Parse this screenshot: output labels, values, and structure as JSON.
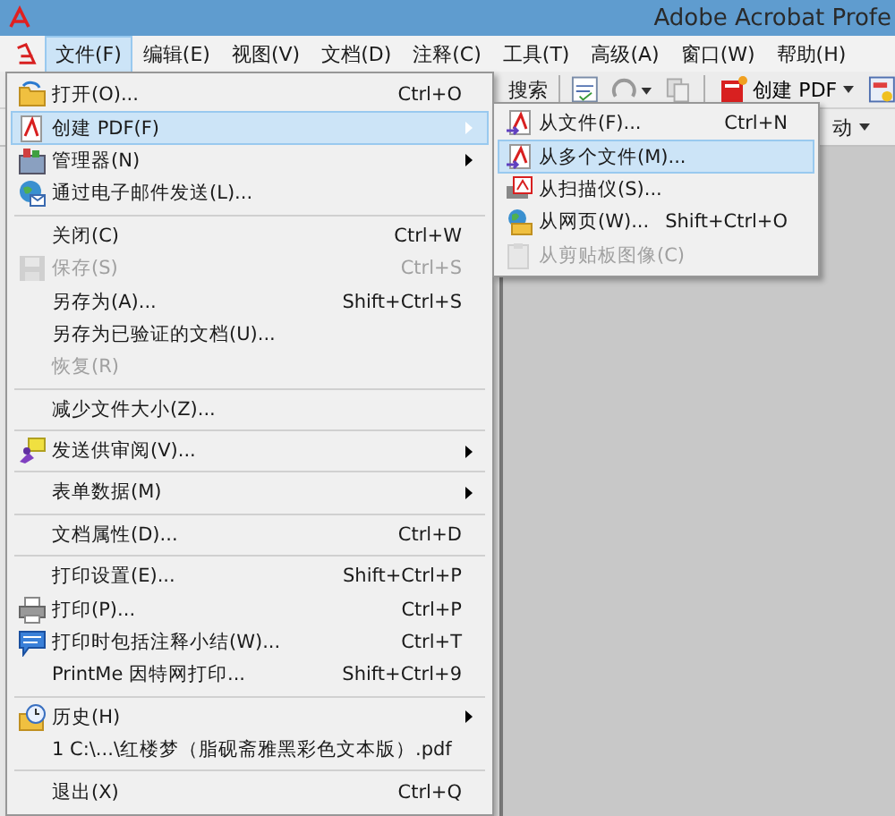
{
  "window": {
    "title": "Adobe Acrobat Profe"
  },
  "menubar": [
    {
      "label": "文件(F)",
      "selected": true
    },
    {
      "label": "编辑(E)",
      "selected": false
    },
    {
      "label": "视图(V)",
      "selected": false
    },
    {
      "label": "文档(D)",
      "selected": false
    },
    {
      "label": "注释(C)",
      "selected": false
    },
    {
      "label": "工具(T)",
      "selected": false
    },
    {
      "label": "高级(A)",
      "selected": false
    },
    {
      "label": "窗口(W)",
      "selected": false
    },
    {
      "label": "帮助(H)",
      "selected": false
    }
  ],
  "toolbar": {
    "search": "搜索",
    "create_pdf": "创建 PDF",
    "row2_text": "动"
  },
  "file_menu": [
    {
      "kind": "item",
      "label": "打开(O)...",
      "shortcut": "Ctrl+O",
      "disabled": false,
      "selected": false,
      "submenu": false
    },
    {
      "kind": "item",
      "label": "创建 PDF(F)",
      "disabled": false,
      "selected": true,
      "submenu": true
    },
    {
      "kind": "item",
      "label": "管理器(N)",
      "disabled": false,
      "selected": false,
      "submenu": true
    },
    {
      "kind": "item",
      "label": "通过电子邮件发送(L)...",
      "disabled": false,
      "selected": false,
      "submenu": false
    },
    {
      "kind": "separator"
    },
    {
      "kind": "item",
      "label": "关闭(C)",
      "shortcut": "Ctrl+W",
      "disabled": false,
      "selected": false,
      "submenu": false
    },
    {
      "kind": "item",
      "label": "保存(S)",
      "shortcut": "Ctrl+S",
      "disabled": true,
      "selected": false,
      "submenu": false
    },
    {
      "kind": "item",
      "label": "另存为(A)...",
      "shortcut": "Shift+Ctrl+S",
      "disabled": false,
      "selected": false,
      "submenu": false
    },
    {
      "kind": "item",
      "label": "另存为已验证的文档(U)...",
      "disabled": false,
      "selected": false,
      "submenu": false
    },
    {
      "kind": "item",
      "label": "恢复(R)",
      "disabled": true,
      "selected": false,
      "submenu": false
    },
    {
      "kind": "separator"
    },
    {
      "kind": "item",
      "label": "减少文件大小(Z)...",
      "disabled": false,
      "selected": false,
      "submenu": false
    },
    {
      "kind": "separator"
    },
    {
      "kind": "item",
      "label": "发送供审阅(V)...",
      "disabled": false,
      "selected": false,
      "submenu": true
    },
    {
      "kind": "separator"
    },
    {
      "kind": "item",
      "label": "表单数据(M)",
      "disabled": false,
      "selected": false,
      "submenu": true
    },
    {
      "kind": "separator"
    },
    {
      "kind": "item",
      "label": "文档属性(D)...",
      "shortcut": "Ctrl+D",
      "disabled": false,
      "selected": false,
      "submenu": false
    },
    {
      "kind": "separator"
    },
    {
      "kind": "item",
      "label": "打印设置(E)...",
      "shortcut": "Shift+Ctrl+P",
      "disabled": false,
      "selected": false,
      "submenu": false
    },
    {
      "kind": "item",
      "label": "打印(P)...",
      "shortcut": "Ctrl+P",
      "disabled": false,
      "selected": false,
      "submenu": false
    },
    {
      "kind": "item",
      "label": "打印时包括注释小结(W)...",
      "shortcut": "Ctrl+T",
      "disabled": false,
      "selected": false,
      "submenu": false
    },
    {
      "kind": "item",
      "label": "PrintMe 因特网打印...",
      "shortcut": "Shift+Ctrl+9",
      "disabled": false,
      "selected": false,
      "submenu": false
    },
    {
      "kind": "separator"
    },
    {
      "kind": "item",
      "label": "历史(H)",
      "disabled": false,
      "selected": false,
      "submenu": true
    },
    {
      "kind": "item",
      "label": "1 C:\\...\\红楼梦（脂砚斋雅黑彩色文本版）.pdf",
      "disabled": false,
      "selected": false,
      "submenu": false
    },
    {
      "kind": "separator"
    },
    {
      "kind": "item",
      "label": "退出(X)",
      "shortcut": "Ctrl+Q",
      "disabled": false,
      "selected": false,
      "submenu": false
    }
  ],
  "create_pdf_submenu": [
    {
      "label": "从文件(F)...",
      "shortcut": "Ctrl+N",
      "disabled": false,
      "selected": false
    },
    {
      "label": "从多个文件(M)...",
      "disabled": false,
      "selected": true
    },
    {
      "label": "从扫描仪(S)...",
      "disabled": false,
      "selected": false
    },
    {
      "label": "从网页(W)...",
      "shortcut": "Shift+Ctrl+O",
      "disabled": false,
      "selected": false
    },
    {
      "label": "从剪贴板图像(C)",
      "disabled": true,
      "selected": false
    }
  ]
}
